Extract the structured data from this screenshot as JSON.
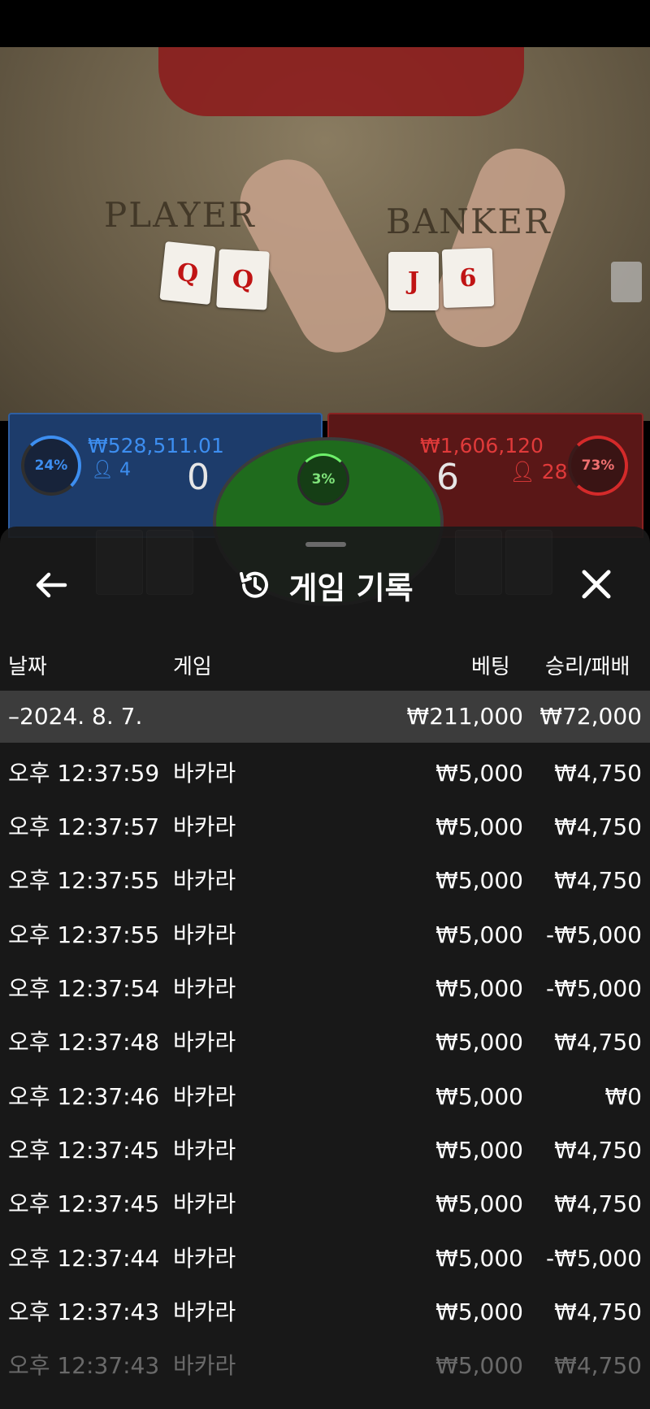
{
  "scene": {
    "table_labels": {
      "player": "PLAYER",
      "banker": "BANKER"
    },
    "player_cards": [
      "Q",
      "Q"
    ],
    "banker_cards": [
      "J",
      "6"
    ],
    "player": {
      "percent": "24%",
      "amount": "₩528,511.01",
      "players": "4",
      "score": "0"
    },
    "banker": {
      "percent": "73%",
      "amount": "₩1,606,120",
      "players": "28",
      "score": "6"
    },
    "tie": {
      "percent": "3%"
    },
    "colors": {
      "player": "#2e6fd1",
      "banker": "#d42a2a",
      "tie": "#2a8f28"
    }
  },
  "history": {
    "title": "게임 기록",
    "icons": {
      "back": "arrow-left-icon",
      "history": "history-icon",
      "close": "close-icon"
    },
    "columns": {
      "date": "날짜",
      "game": "게임",
      "bet": "베팅",
      "result": "승리/패배"
    },
    "group": {
      "date": "–2024. 8. 7.",
      "bet_total": "₩211,000",
      "result_total": "₩72,000"
    },
    "rows": [
      {
        "time": "오후 12:37:59",
        "game": "바카라",
        "bet": "₩5,000",
        "result": "₩4,750"
      },
      {
        "time": "오후 12:37:57",
        "game": "바카라",
        "bet": "₩5,000",
        "result": "₩4,750"
      },
      {
        "time": "오후 12:37:55",
        "game": "바카라",
        "bet": "₩5,000",
        "result": "₩4,750"
      },
      {
        "time": "오후 12:37:55",
        "game": "바카라",
        "bet": "₩5,000",
        "result": "-₩5,000"
      },
      {
        "time": "오후 12:37:54",
        "game": "바카라",
        "bet": "₩5,000",
        "result": "-₩5,000"
      },
      {
        "time": "오후 12:37:48",
        "game": "바카라",
        "bet": "₩5,000",
        "result": "₩4,750"
      },
      {
        "time": "오후 12:37:46",
        "game": "바카라",
        "bet": "₩5,000",
        "result": "₩0"
      },
      {
        "time": "오후 12:37:45",
        "game": "바카라",
        "bet": "₩5,000",
        "result": "₩4,750"
      },
      {
        "time": "오후 12:37:45",
        "game": "바카라",
        "bet": "₩5,000",
        "result": "₩4,750"
      },
      {
        "time": "오후 12:37:44",
        "game": "바카라",
        "bet": "₩5,000",
        "result": "-₩5,000"
      },
      {
        "time": "오후 12:37:43",
        "game": "바카라",
        "bet": "₩5,000",
        "result": "₩4,750"
      },
      {
        "time": "오후 12:37:43",
        "game": "바카라",
        "bet": "₩5,000",
        "result": "₩4,750"
      }
    ]
  }
}
